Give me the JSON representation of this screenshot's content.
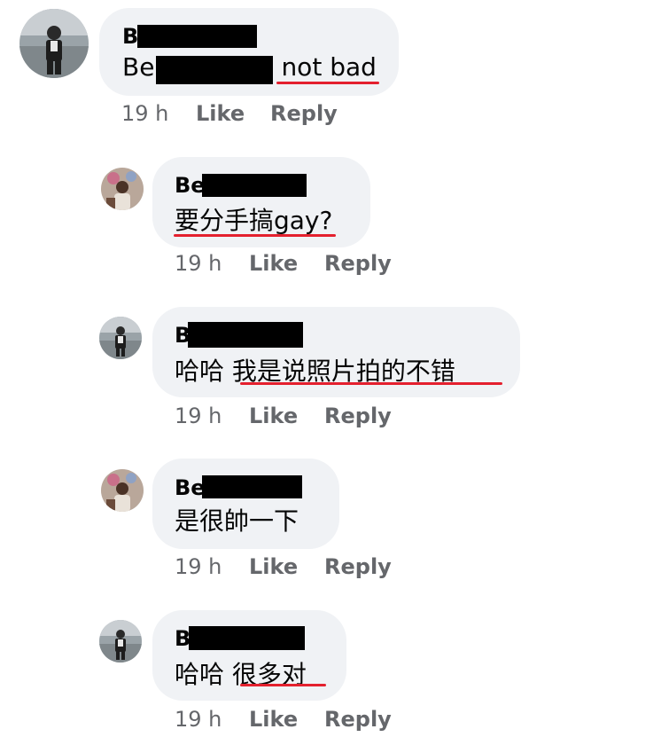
{
  "comments": [
    {
      "name_visible": "B",
      "text_prefix": "Be",
      "text_highlight": "not bad",
      "time": "19 h",
      "like": "Like",
      "reply": "Reply"
    }
  ],
  "replies": [
    {
      "name_visible": "Be",
      "text_main": "要分手搞gay?",
      "time": "19 h",
      "like": "Like",
      "reply": "Reply"
    },
    {
      "name_visible": "B",
      "text_prefix": "哈哈 ",
      "text_highlight": "我是说照片拍的不错",
      "time": "19 h",
      "like": "Like",
      "reply": "Reply"
    },
    {
      "name_visible": "Be",
      "text_main": "是很帥一下",
      "time": "19 h",
      "like": "Like",
      "reply": "Reply"
    },
    {
      "name_visible": "B",
      "text_prefix": "哈哈 ",
      "text_highlight": "很多对",
      "time": "19 h",
      "like": "Like",
      "reply": "Reply"
    }
  ],
  "colors": {
    "bubble": "#f0f2f5",
    "underline": "#e4202e",
    "meta": "#65676b"
  },
  "icons": {
    "man_avatar": "man-avatar-icon",
    "woman_avatar": "woman-avatar-icon"
  }
}
